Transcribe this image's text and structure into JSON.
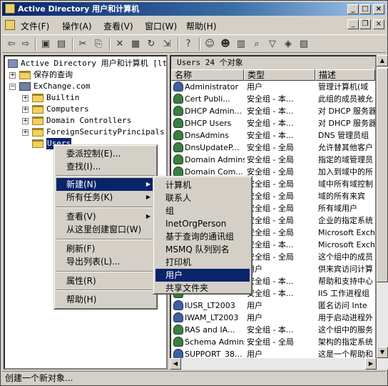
{
  "window": {
    "title": "Active Directory 用户和计算机",
    "min": "_",
    "max": "□",
    "close": "×"
  },
  "menubar": [
    "文件(F)",
    "操作(A)",
    "查看(V)",
    "窗口(W)",
    "帮助(H)"
  ],
  "tree": {
    "root": "Active Directory 用户和计算机 [lt2",
    "items": [
      {
        "label": "保存的查询",
        "level": 1,
        "expand": "+"
      },
      {
        "label": "ExChange.com",
        "level": 1,
        "expand": "−"
      },
      {
        "label": "Builtin",
        "level": 2,
        "expand": "+"
      },
      {
        "label": "Computers",
        "level": 2,
        "expand": "+"
      },
      {
        "label": "Domain Controllers",
        "level": 2,
        "expand": "+"
      },
      {
        "label": "ForeignSecurityPrincipals",
        "level": 2,
        "expand": "+"
      },
      {
        "label": "Users",
        "level": 2,
        "expand": "",
        "selected": true
      }
    ]
  },
  "list": {
    "header": "Users    24 个对象",
    "columns": [
      "名称",
      "类型",
      "描述"
    ],
    "rows": [
      [
        "Administrator",
        "用户",
        "管理计算机(域"
      ],
      [
        "Cert Publi...",
        "安全组 - 本...",
        "此组的成员被允"
      ],
      [
        "DHCP Admin...",
        "安全组 - 本...",
        "对 DHCP 服务器"
      ],
      [
        "DHCP Users",
        "安全组 - 本...",
        "对 DHCP 服务器"
      ],
      [
        "DnsAdmins",
        "安全组 - 本...",
        "DNS 管理员组"
      ],
      [
        "DnsUpdateP...",
        "安全组 - 全局",
        "允许替其他客户"
      ],
      [
        "Domain Admins",
        "安全组 - 全局",
        "指定的域管理员"
      ],
      [
        "Domain Com...",
        "安全组 - 全局",
        "加入到域中的所"
      ],
      [
        "",
        "安全组 - 全局",
        "域中所有域控制"
      ],
      [
        "",
        "安全组 - 全局",
        "域的所有来宾"
      ],
      [
        "",
        "安全组 - 全局",
        "所有域用户"
      ],
      [
        "",
        "安全组 - 全局",
        "企业的指定系统"
      ],
      [
        "",
        "安全组 - 全局",
        "Microsoft Exch"
      ],
      [
        "",
        "安全组 - 本...",
        "Microsoft Exch"
      ],
      [
        "",
        "安全组 - 全局",
        "这个组中的成员"
      ],
      [
        "",
        "用户",
        "供来宾访问计算"
      ],
      [
        "",
        "安全组 - 本...",
        "帮助和支持中心"
      ],
      [
        "",
        "安全组 - 本...",
        "IIS 工作进程组"
      ],
      [
        "IUSR_LT2003",
        "用户",
        "匿名访问 Inte"
      ],
      [
        "IWAM_LT2003",
        "用户",
        "用于启动进程外"
      ],
      [
        "RAS and IA...",
        "安全组 - 本...",
        "这个组中的服务"
      ],
      [
        "Schema Admins",
        "安全组 - 全局",
        "架构的指定系统"
      ],
      [
        "SUPPORT_38...",
        "用户",
        "这是一个帮助和"
      ]
    ]
  },
  "context_menu": [
    "委派控制(E)...",
    "查找(I)...",
    "新建(N)",
    "所有任务(K)",
    "查看(V)",
    "从这里创建窗口(W)",
    "刷新(F)",
    "导出列表(L)...",
    "属性(R)",
    "帮助(H)"
  ],
  "new_submenu": [
    "计算机",
    "联系人",
    "组",
    "InetOrgPerson",
    "基于查询的通讯组",
    "MSMQ 队列别名",
    "打印机",
    "用户",
    "共享文件夹"
  ],
  "status": "创建一个新对象..."
}
